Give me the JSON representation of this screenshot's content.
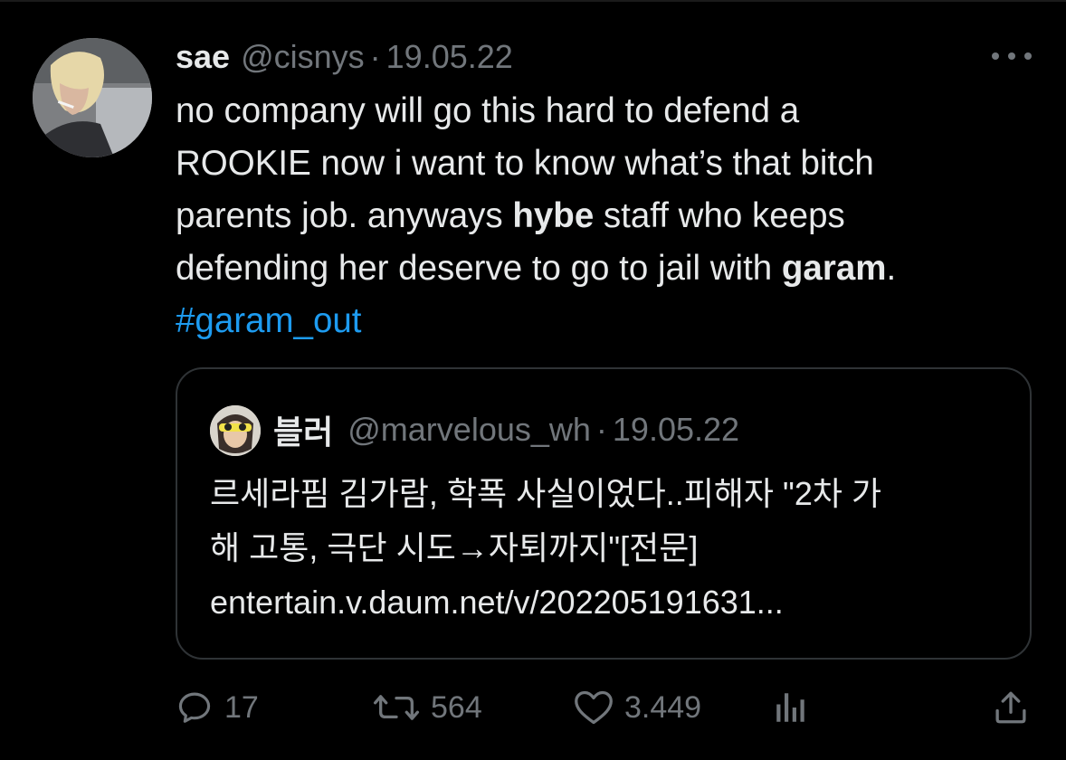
{
  "tweet": {
    "author_name": "sae",
    "handle": "@cisnys",
    "separator": "·",
    "date": "19.05.22",
    "text_parts": {
      "line1": "no company will go this hard to defend a",
      "line2": "ROOKIE now i want to know what’s that bitch",
      "line3_a": "parents job. anyways ",
      "line3_b": "hybe",
      "line3_c": " staff who keeps",
      "line4_a": "defending her deserve to go to jail with ",
      "line4_b": "garam",
      "line4_c": ".",
      "hashtag": "#garam_out"
    },
    "avatar_icon": "profile-photo",
    "more_icon": "more-horizontal-icon"
  },
  "quoted": {
    "author_name": "블러",
    "handle": "@marvelous_wh",
    "separator": "·",
    "date": "19.05.22",
    "lines": {
      "l1": "르세라핌 김가람, 학폭 사실이었다..피해자 \"2차 가",
      "l2": "해 고통, 극단 시도→자퇴까지\"[전문]",
      "l3": "entertain.v.daum.net/v/202205191631..."
    }
  },
  "actions": {
    "reply": {
      "icon": "reply-icon",
      "count": "17"
    },
    "retweet": {
      "icon": "retweet-icon",
      "count": "564"
    },
    "like": {
      "icon": "like-heart-icon",
      "count": "3.449"
    },
    "views": {
      "icon": "analytics-icon"
    },
    "share": {
      "icon": "share-icon"
    }
  },
  "colors": {
    "background": "#000000",
    "text": "#e7e9ea",
    "muted": "#71767b",
    "link": "#1d9bf0",
    "border": "#2f3336"
  }
}
